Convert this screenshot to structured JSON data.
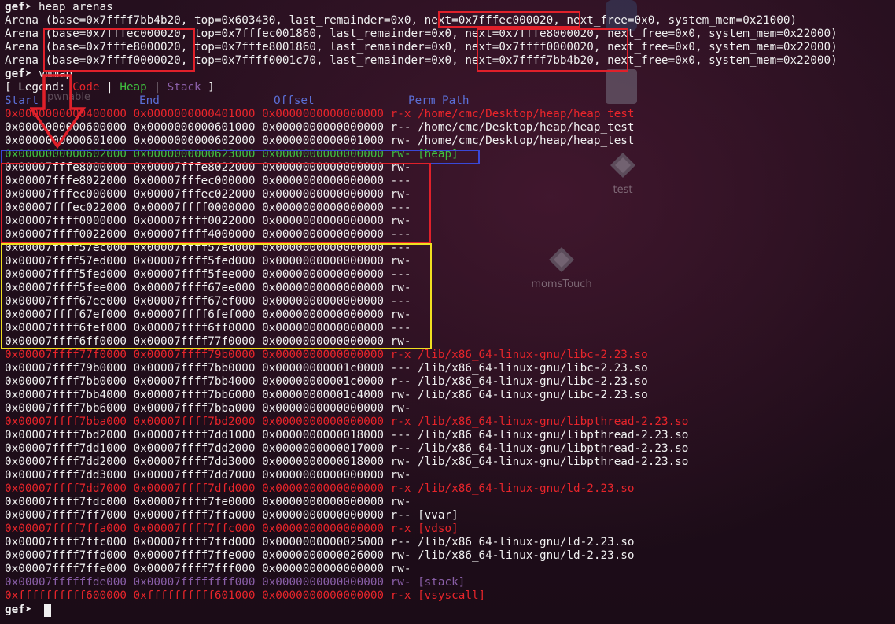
{
  "prompt": "gef➤",
  "commands": {
    "arenas": "heap arenas",
    "vmmap": "vmmap"
  },
  "arenas": [
    {
      "a": "Arena (base=0x7ffff7bb4b20, top=0x603430, last_remainder=0x0, ",
      "b": "next=0x7fffec000020",
      "c": ", next_free=0x0, system_mem=0x21000)"
    },
    {
      "a": "Arena (base=0x7fffec000020, top=0x7fffec001860, last_remainder=0x0, ",
      "b": "next=0x7fffe8000020",
      "c": ", next_free=0x0, system_mem=0x22000)"
    },
    {
      "a": "Arena (base=0x7fffe8000020, top=0x7fffe8001860, last_remainder=0x0, ",
      "b": "next=0x7ffff0000020",
      "c": ", next_free=0x0, system_mem=0x22000)"
    },
    {
      "a": "Arena (base=0x7ffff0000020, top=0x7ffff0001c70, last_remainder=0x0, ",
      "b": "next=0x7ffff7bb4b20",
      "c": ", next_free=0x0, system_mem=0x22000)"
    }
  ],
  "legend": {
    "open": "[ Legend: ",
    "code": "Code",
    "sep": " | ",
    "heap": "Heap",
    "stack": "Stack",
    "close": " ]"
  },
  "header": {
    "start": "Start",
    "end": "End",
    "offset": "Offset",
    "perm": "Perm",
    "path": "Path"
  },
  "vmmap_rows": [
    {
      "start": "0x0000000000400000",
      "end": "0x0000000000401000",
      "offset": "0x0000000000000000",
      "perm": "r-x",
      "path": "/home/cmc/Desktop/heap/heap_test",
      "color": "r"
    },
    {
      "start": "0x0000000000600000",
      "end": "0x0000000000601000",
      "offset": "0x0000000000000000",
      "perm": "r--",
      "path": "/home/cmc/Desktop/heap/heap_test",
      "color": "w"
    },
    {
      "start": "0x0000000000601000",
      "end": "0x0000000000602000",
      "offset": "0x0000000000001000",
      "perm": "rw-",
      "path": "/home/cmc/Desktop/heap/heap_test",
      "color": "w"
    },
    {
      "start": "0x0000000000602000",
      "end": "0x0000000000623000",
      "offset": "0x0000000000000000",
      "perm": "rw-",
      "path": "[heap]",
      "color": "g"
    },
    {
      "start": "0x00007fffe8000000",
      "end": "0x00007fffe8022000",
      "offset": "0x0000000000000000",
      "perm": "rw-",
      "path": "",
      "color": "w"
    },
    {
      "start": "0x00007fffe8022000",
      "end": "0x00007fffec000000",
      "offset": "0x0000000000000000",
      "perm": "---",
      "path": "",
      "color": "w"
    },
    {
      "start": "0x00007fffec000000",
      "end": "0x00007fffec022000",
      "offset": "0x0000000000000000",
      "perm": "rw-",
      "path": "",
      "color": "w"
    },
    {
      "start": "0x00007fffec022000",
      "end": "0x00007ffff0000000",
      "offset": "0x0000000000000000",
      "perm": "---",
      "path": "",
      "color": "w"
    },
    {
      "start": "0x00007ffff0000000",
      "end": "0x00007ffff0022000",
      "offset": "0x0000000000000000",
      "perm": "rw-",
      "path": "",
      "color": "w"
    },
    {
      "start": "0x00007ffff0022000",
      "end": "0x00007ffff4000000",
      "offset": "0x0000000000000000",
      "perm": "---",
      "path": "",
      "color": "w"
    },
    {
      "start": "0x00007ffff57ec000",
      "end": "0x00007ffff57ed000",
      "offset": "0x0000000000000000",
      "perm": "---",
      "path": "",
      "color": "w"
    },
    {
      "start": "0x00007ffff57ed000",
      "end": "0x00007ffff5fed000",
      "offset": "0x0000000000000000",
      "perm": "rw-",
      "path": "",
      "color": "w"
    },
    {
      "start": "0x00007ffff5fed000",
      "end": "0x00007ffff5fee000",
      "offset": "0x0000000000000000",
      "perm": "---",
      "path": "",
      "color": "w"
    },
    {
      "start": "0x00007ffff5fee000",
      "end": "0x00007ffff67ee000",
      "offset": "0x0000000000000000",
      "perm": "rw-",
      "path": "",
      "color": "w"
    },
    {
      "start": "0x00007ffff67ee000",
      "end": "0x00007ffff67ef000",
      "offset": "0x0000000000000000",
      "perm": "---",
      "path": "",
      "color": "w"
    },
    {
      "start": "0x00007ffff67ef000",
      "end": "0x00007ffff6fef000",
      "offset": "0x0000000000000000",
      "perm": "rw-",
      "path": "",
      "color": "w"
    },
    {
      "start": "0x00007ffff6fef000",
      "end": "0x00007ffff6ff0000",
      "offset": "0x0000000000000000",
      "perm": "---",
      "path": "",
      "color": "w"
    },
    {
      "start": "0x00007ffff6ff0000",
      "end": "0x00007ffff77f0000",
      "offset": "0x0000000000000000",
      "perm": "rw-",
      "path": "",
      "color": "w"
    },
    {
      "start": "0x00007ffff77f0000",
      "end": "0x00007ffff79b0000",
      "offset": "0x0000000000000000",
      "perm": "r-x",
      "path": "/lib/x86_64-linux-gnu/libc-2.23.so",
      "color": "r"
    },
    {
      "start": "0x00007ffff79b0000",
      "end": "0x00007ffff7bb0000",
      "offset": "0x00000000001c0000",
      "perm": "---",
      "path": "/lib/x86_64-linux-gnu/libc-2.23.so",
      "color": "w"
    },
    {
      "start": "0x00007ffff7bb0000",
      "end": "0x00007ffff7bb4000",
      "offset": "0x00000000001c0000",
      "perm": "r--",
      "path": "/lib/x86_64-linux-gnu/libc-2.23.so",
      "color": "w"
    },
    {
      "start": "0x00007ffff7bb4000",
      "end": "0x00007ffff7bb6000",
      "offset": "0x00000000001c4000",
      "perm": "rw-",
      "path": "/lib/x86_64-linux-gnu/libc-2.23.so",
      "color": "w"
    },
    {
      "start": "0x00007ffff7bb6000",
      "end": "0x00007ffff7bba000",
      "offset": "0x0000000000000000",
      "perm": "rw-",
      "path": "",
      "color": "w"
    },
    {
      "start": "0x00007ffff7bba000",
      "end": "0x00007ffff7bd2000",
      "offset": "0x0000000000000000",
      "perm": "r-x",
      "path": "/lib/x86_64-linux-gnu/libpthread-2.23.so",
      "color": "r"
    },
    {
      "start": "0x00007ffff7bd2000",
      "end": "0x00007ffff7dd1000",
      "offset": "0x0000000000018000",
      "perm": "---",
      "path": "/lib/x86_64-linux-gnu/libpthread-2.23.so",
      "color": "w"
    },
    {
      "start": "0x00007ffff7dd1000",
      "end": "0x00007ffff7dd2000",
      "offset": "0x0000000000017000",
      "perm": "r--",
      "path": "/lib/x86_64-linux-gnu/libpthread-2.23.so",
      "color": "w"
    },
    {
      "start": "0x00007ffff7dd2000",
      "end": "0x00007ffff7dd3000",
      "offset": "0x0000000000018000",
      "perm": "rw-",
      "path": "/lib/x86_64-linux-gnu/libpthread-2.23.so",
      "color": "w"
    },
    {
      "start": "0x00007ffff7dd3000",
      "end": "0x00007ffff7dd7000",
      "offset": "0x0000000000000000",
      "perm": "rw-",
      "path": "",
      "color": "w"
    },
    {
      "start": "0x00007ffff7dd7000",
      "end": "0x00007ffff7dfd000",
      "offset": "0x0000000000000000",
      "perm": "r-x",
      "path": "/lib/x86_64-linux-gnu/ld-2.23.so",
      "color": "r"
    },
    {
      "start": "0x00007ffff7fdc000",
      "end": "0x00007ffff7fe0000",
      "offset": "0x0000000000000000",
      "perm": "rw-",
      "path": "",
      "color": "w"
    },
    {
      "start": "0x00007ffff7ff7000",
      "end": "0x00007ffff7ffa000",
      "offset": "0x0000000000000000",
      "perm": "r--",
      "path": "[vvar]",
      "color": "w"
    },
    {
      "start": "0x00007ffff7ffa000",
      "end": "0x00007ffff7ffc000",
      "offset": "0x0000000000000000",
      "perm": "r-x",
      "path": "[vdso]",
      "color": "r"
    },
    {
      "start": "0x00007ffff7ffc000",
      "end": "0x00007ffff7ffd000",
      "offset": "0x0000000000025000",
      "perm": "r--",
      "path": "/lib/x86_64-linux-gnu/ld-2.23.so",
      "color": "w"
    },
    {
      "start": "0x00007ffff7ffd000",
      "end": "0x00007ffff7ffe000",
      "offset": "0x0000000000026000",
      "perm": "rw-",
      "path": "/lib/x86_64-linux-gnu/ld-2.23.so",
      "color": "w"
    },
    {
      "start": "0x00007ffff7ffe000",
      "end": "0x00007ffff7fff000",
      "offset": "0x0000000000000000",
      "perm": "rw-",
      "path": "",
      "color": "w"
    },
    {
      "start": "0x00007ffffffde000",
      "end": "0x00007ffffffff000",
      "offset": "0x0000000000000000",
      "perm": "rw-",
      "path": "[stack]",
      "color": "p"
    },
    {
      "start": "0xffffffffff600000",
      "end": "0xffffffffff601000",
      "offset": "0x0000000000000000",
      "perm": "r-x",
      "path": "[vsyscall]",
      "color": "r"
    }
  ],
  "desktop_icons": {
    "test": "test",
    "momstouch": "momsTouch",
    "pwnable": "pwnable"
  },
  "colors": {
    "code": "#e8252b",
    "heap": "#3fbf3f",
    "stack": "#8a5fa8",
    "header": "#5b6fd6",
    "annot_red": "#e0202a",
    "annot_blue": "#3a48d6",
    "annot_yellow": "#f0e020"
  }
}
